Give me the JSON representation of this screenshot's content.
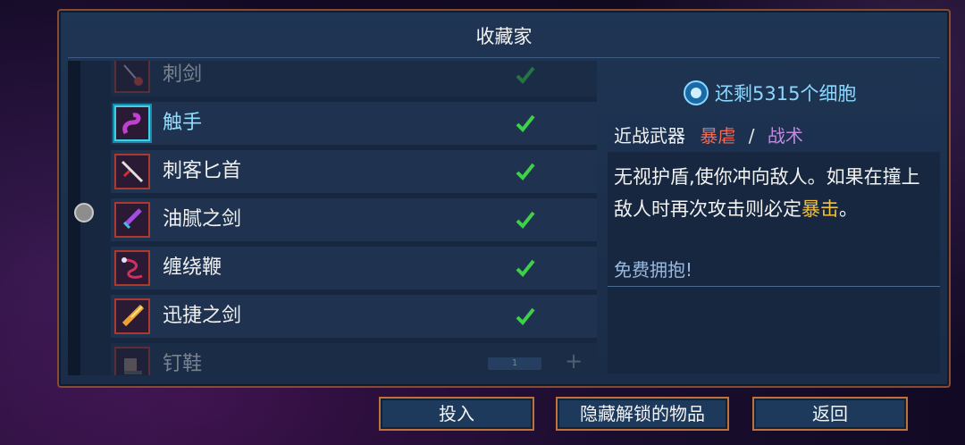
{
  "window": {
    "title": "收藏家"
  },
  "currency": {
    "icon": "cell-icon",
    "text": "还剩5315个细胞"
  },
  "items": [
    {
      "name": "刺剑",
      "icon": "rapier-icon",
      "unlocked": true
    },
    {
      "name": "触手",
      "icon": "tentacle-icon",
      "unlocked": true
    },
    {
      "name": "刺客匕首",
      "icon": "assassin-dagger-icon",
      "unlocked": true
    },
    {
      "name": "油腻之剑",
      "icon": "oiled-sword-icon",
      "unlocked": true
    },
    {
      "name": "缠绕鞭",
      "icon": "wrenching-whip-icon",
      "unlocked": true
    },
    {
      "name": "迅捷之剑",
      "icon": "swift-sword-icon",
      "unlocked": true
    },
    {
      "name": "钉鞋",
      "icon": "spiked-boots-icon",
      "unlocked": false,
      "count": "1",
      "plus": "+"
    }
  ],
  "detail": {
    "category": "近战武器",
    "tag1": "暴虐",
    "slash": "/",
    "tag2": "战术",
    "desc_part1": "无视护盾,使你冲向敌人。如果在撞上敌人时再次攻击则必定",
    "desc_crit": "暴击",
    "desc_end": "。",
    "free": "免费拥抱!"
  },
  "buttons": {
    "invest": "投入",
    "hide_unlocked": "隐藏解锁的物品",
    "back": "返回"
  },
  "colors": {
    "brutality": "#f06a5a",
    "tactics": "#c08ae0",
    "crit": "#f0c040",
    "frame_border": "#8a4a32"
  }
}
